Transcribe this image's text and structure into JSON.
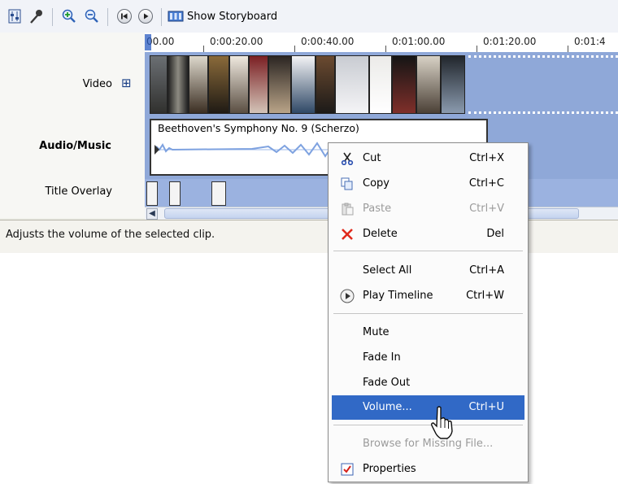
{
  "toolbar": {
    "storyboard_label": "Show Storyboard"
  },
  "ruler": {
    "ticks": [
      "00.00",
      "0:00:20.00",
      "0:00:40.00",
      "0:01:00.00",
      "0:01:20.00",
      "0:01:4"
    ]
  },
  "tracks": {
    "video": "Video",
    "audio": "Audio/Music",
    "title": "Title Overlay",
    "expand_symbol": "⊞"
  },
  "audio_clip": {
    "name": "Beethoven's Symphony No. 9 (Scherzo)"
  },
  "status": {
    "text": "Adjusts the volume of the selected clip."
  },
  "menu": {
    "cut": {
      "label": "Cut",
      "shortcut": "Ctrl+X"
    },
    "copy": {
      "label": "Copy",
      "shortcut": "Ctrl+C"
    },
    "paste": {
      "label": "Paste",
      "shortcut": "Ctrl+V"
    },
    "delete": {
      "label": "Delete",
      "shortcut": "Del"
    },
    "select_all": {
      "label": "Select All",
      "shortcut": "Ctrl+A"
    },
    "play_timeline": {
      "label": "Play Timeline",
      "shortcut": "Ctrl+W"
    },
    "mute": {
      "label": "Mute"
    },
    "fade_in": {
      "label": "Fade In"
    },
    "fade_out": {
      "label": "Fade Out"
    },
    "volume": {
      "label": "Volume...",
      "shortcut": "Ctrl+U"
    },
    "browse": {
      "label": "Browse for Missing File..."
    },
    "properties": {
      "label": "Properties"
    }
  },
  "colors": {
    "track_blue": "#8fa8d8",
    "highlight": "#3169c6",
    "delete_red": "#e0291b"
  }
}
